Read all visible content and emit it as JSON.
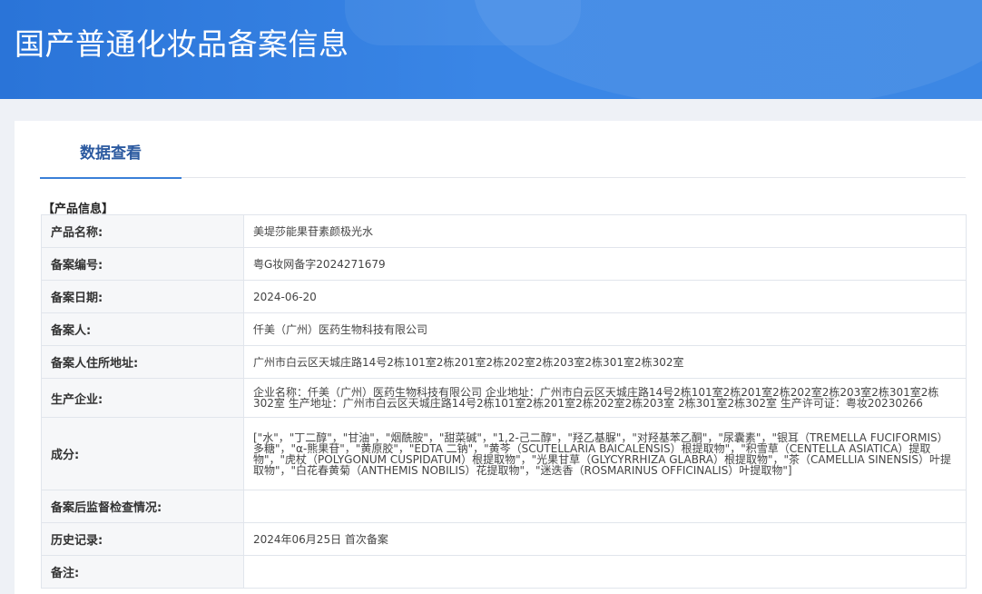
{
  "header": {
    "title": "国产普通化妆品备案信息"
  },
  "tabs": [
    {
      "label": "数据查看"
    }
  ],
  "section": {
    "title": "【产品信息】"
  },
  "rows": [
    {
      "label": "产品名称:",
      "value": "美堤莎能果苷素颜极光水"
    },
    {
      "label": "备案编号:",
      "value": "粤G妆网备字2024271679"
    },
    {
      "label": "备案日期:",
      "value": "2024-06-20"
    },
    {
      "label": "备案人:",
      "value": "仟美（广州）医药生物科技有限公司"
    },
    {
      "label": "备案人住所地址:",
      "value": "广州市白云区天城庄路14号2栋101室2栋201室2栋202室2栋203室2栋301室2栋302室"
    },
    {
      "label": "生产企业:",
      "value": "企业名称：仟美（广州）医药生物科技有限公司 企业地址：广州市白云区天城庄路14号2栋101室2栋201室2栋202室2栋203室2栋301室2栋302室 生产地址：广州市白云区天城庄路14号2栋101室2栋201室2栋202室2栋203室 2栋301室2栋302室 生产许可证：粤妆20230266"
    },
    {
      "label": "成分:",
      "value": "[\"水\"，\"丁二醇\"，\"甘油\"，\"烟酰胺\"，\"甜菜碱\"，\"1,2-己二醇\"，\"羟乙基脲\"，\"对羟基苯乙酮\"，\"尿囊素\"，\"银耳（TREMELLA FUCIFORMIS）多糖\"，\"α-熊果苷\"，\"黄原胶\"，\"EDTA 二钠\"，\"黄芩（SCUTELLARIA BAICALENSIS）根提取物\"，\"积雪草（CENTELLA ASIATICA）提取物\"，\"虎杖（POLYGONUM CUSPIDATUM）根提取物\"，\"光果甘草（GLYCYRRHIZA GLABRA）根提取物\"，\"茶（CAMELLIA SINENSIS）叶提取物\"，\"白花春黄菊（ANTHEMIS NOBILIS）花提取物\"，\"迷迭香（ROSMARINUS OFFICINALIS）叶提取物\"]"
    },
    {
      "label": "备案后监督检查情况:",
      "value": ""
    },
    {
      "label": "历史记录:",
      "value": "2024年06月25日 首次备案"
    },
    {
      "label": "备注:",
      "value": ""
    }
  ]
}
